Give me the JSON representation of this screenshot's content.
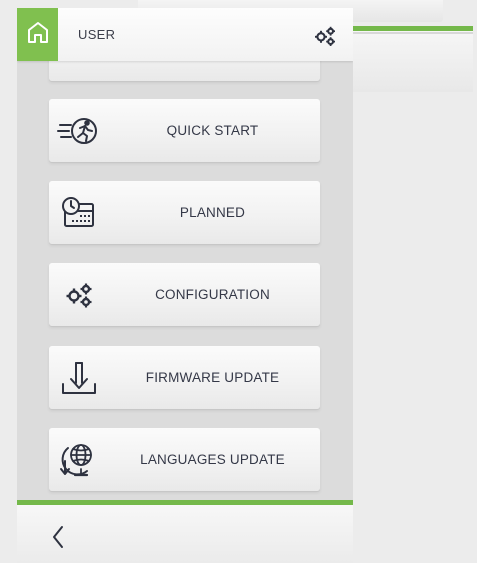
{
  "header": {
    "title": "USER",
    "home_icon": "home-icon",
    "settings_icon": "gears-icon"
  },
  "menu": {
    "items": [
      {
        "label": "",
        "icon": "partial-item-icon"
      },
      {
        "label": "QUICK START",
        "icon": "quick-start-icon"
      },
      {
        "label": "PLANNED",
        "icon": "calendar-clock-icon"
      },
      {
        "label": "CONFIGURATION",
        "icon": "gears-icon"
      },
      {
        "label": "FIRMWARE UPDATE",
        "icon": "download-icon"
      },
      {
        "label": "LANGUAGES UPDATE",
        "icon": "globe-download-icon"
      }
    ]
  },
  "footer": {
    "back_icon": "chevron-left-icon"
  },
  "colors": {
    "accent_green": "#80c04f",
    "text_dark": "#343847",
    "icon_dark": "#2e3240"
  }
}
